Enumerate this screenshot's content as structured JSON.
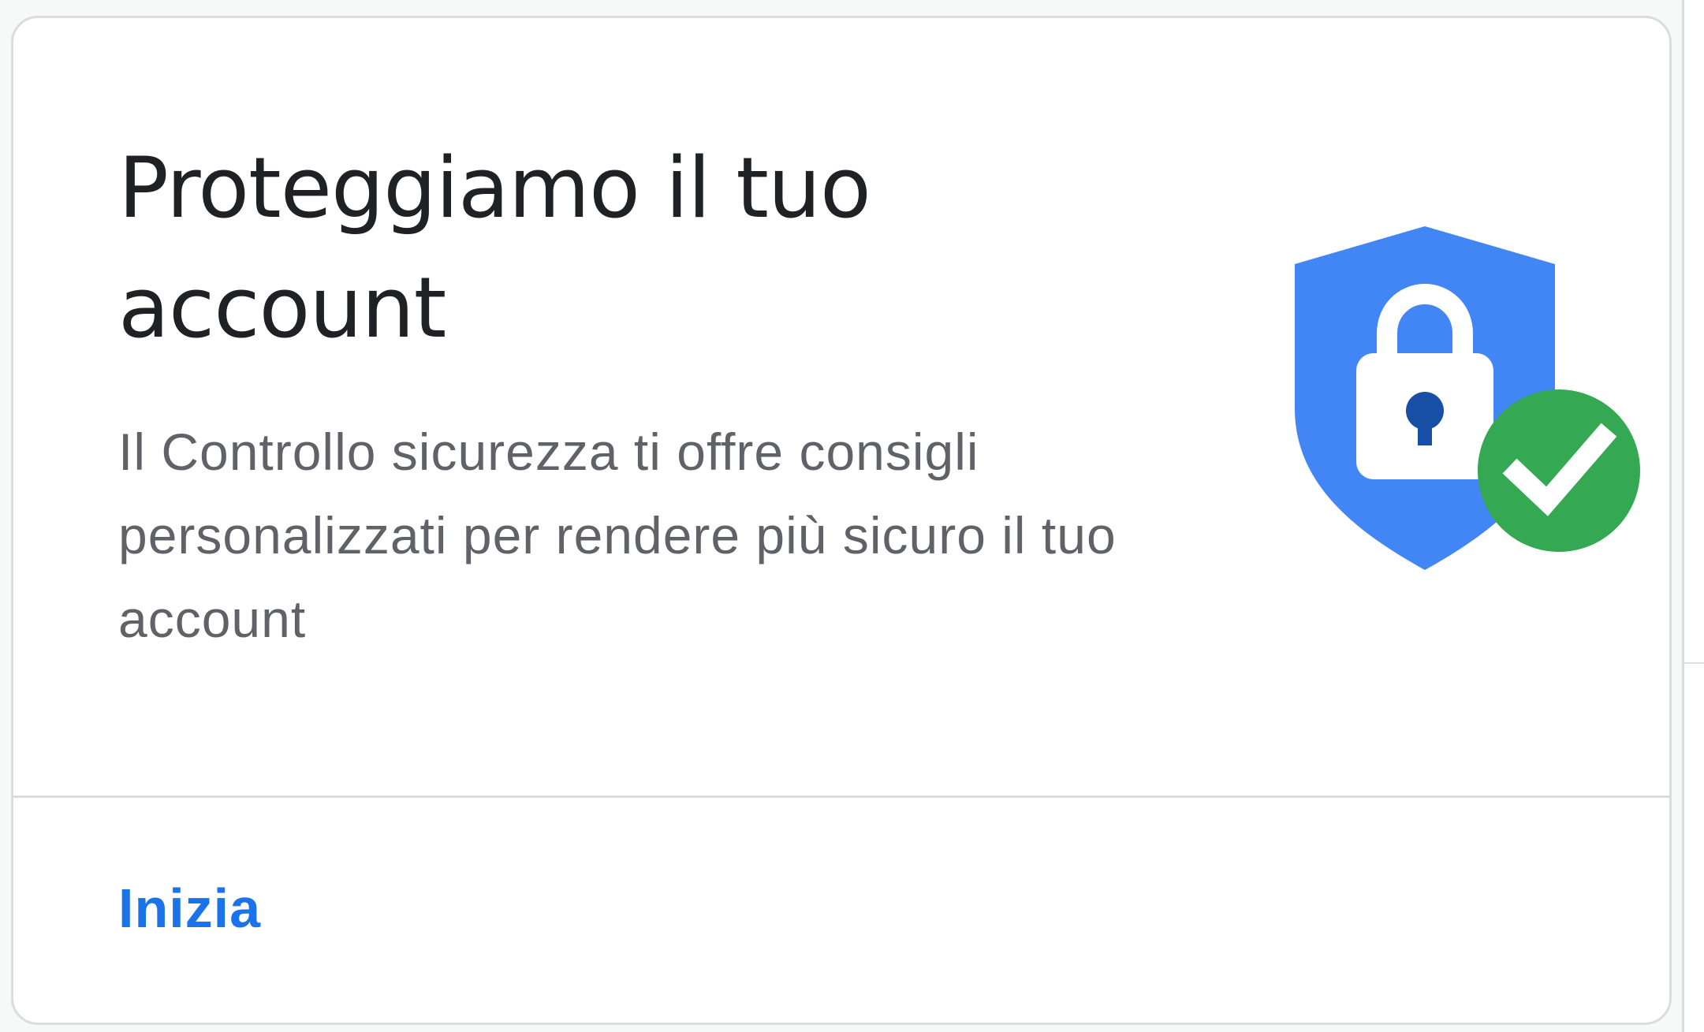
{
  "card": {
    "title": "Proteggiamo il tuo account",
    "description": "Il Controllo sicurezza ti offre consigli personalizzati per rendere più sicuro il tuo account",
    "action_label": "Inizia",
    "illustration_icon": "shield-lock-check-icon"
  },
  "colors": {
    "accent": "#1a73e8",
    "shield_blue": "#4285f4",
    "check_green": "#34a853",
    "keyhole_dark": "#174ea6",
    "title_text": "#202124",
    "body_text": "#5f6368",
    "border": "#dadce0"
  }
}
